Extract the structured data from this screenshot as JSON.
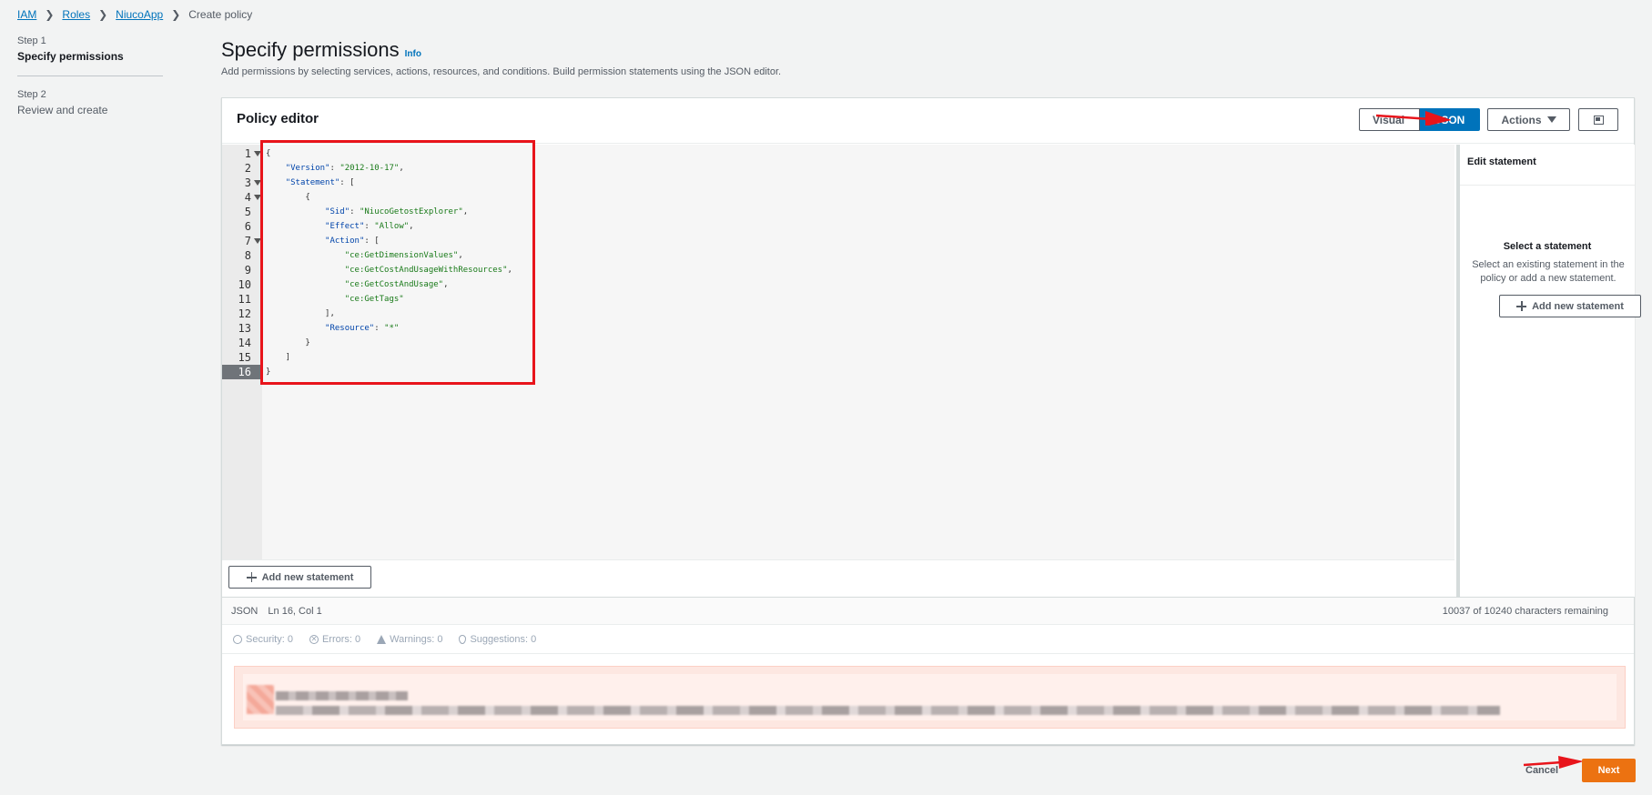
{
  "breadcrumb": {
    "items": [
      "IAM",
      "Roles",
      "NiucoApp"
    ],
    "current": "Create policy"
  },
  "steps": [
    {
      "label": "Step 1",
      "title": "Specify permissions"
    },
    {
      "label": "Step 2",
      "title": "Review and create"
    }
  ],
  "header": {
    "title": "Specify permissions",
    "info": "Info",
    "description": "Add permissions by selecting services, actions, resources, and conditions. Build permission statements using the JSON editor."
  },
  "policy_editor": {
    "title": "Policy editor",
    "visual_label": "Visual",
    "json_label": "JSON",
    "actions_label": "Actions",
    "code_lines": [
      "{",
      "    \"Version\": \"2012-10-17\",",
      "    \"Statement\": [",
      "        {",
      "            \"Sid\": \"NiucoGetostExplorer\",",
      "            \"Effect\": \"Allow\",",
      "            \"Action\": [",
      "                \"ce:GetDimensionValues\",",
      "                \"ce:GetCostAndUsageWithResources\",",
      "                \"ce:GetCostAndUsage\",",
      "                \"ce:GetTags\"",
      "            ],",
      "            \"Resource\": \"*\"",
      "        }",
      "    ]",
      "}"
    ],
    "line_numbers": [
      "1",
      "2",
      "3",
      "4",
      "5",
      "6",
      "7",
      "8",
      "9",
      "10",
      "11",
      "12",
      "13",
      "14",
      "15",
      "16"
    ],
    "add_statement_label": "Add new statement"
  },
  "edit_statement": {
    "title": "Edit statement",
    "empty_title": "Select a statement",
    "empty_desc": "Select an existing statement in the policy or add a new statement.",
    "add_label": "Add new statement"
  },
  "status": {
    "mode": "JSON",
    "position": "Ln 16, Col 1",
    "remaining": "10037 of 10240 characters remaining"
  },
  "checks": {
    "security": "Security: 0",
    "errors": "Errors: 0",
    "warnings": "Warnings: 0",
    "suggestions": "Suggestions: 0"
  },
  "footer": {
    "cancel": "Cancel",
    "next": "Next"
  },
  "colors": {
    "link": "#0073bb",
    "primary": "#ec7211",
    "annotation": "#e8141b"
  }
}
